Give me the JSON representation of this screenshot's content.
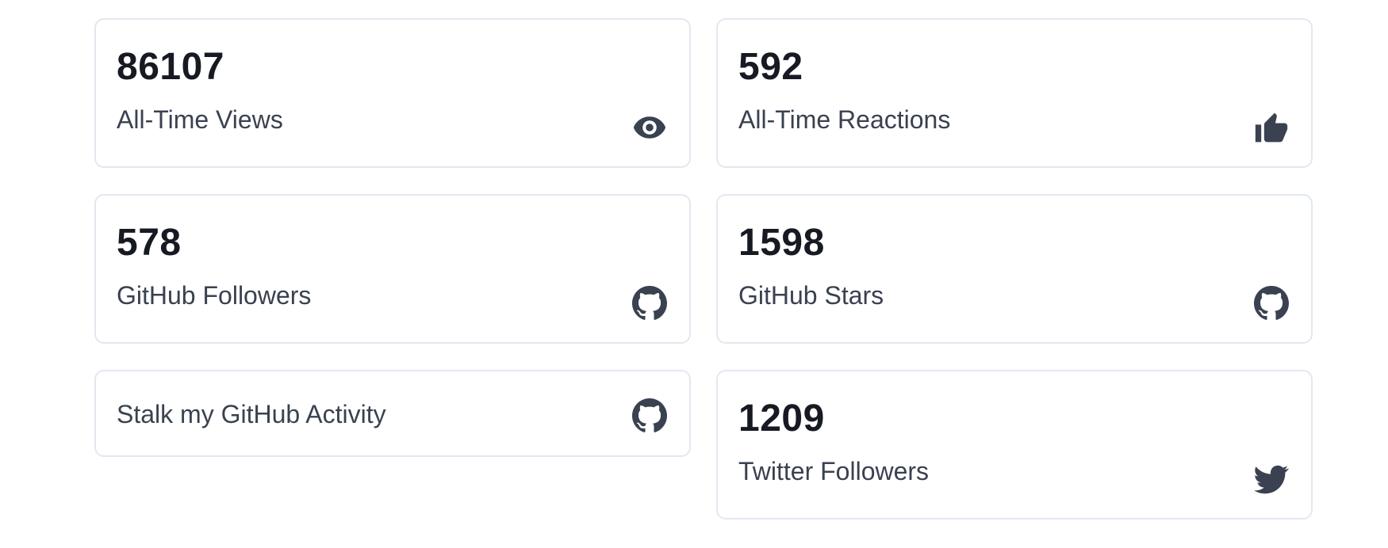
{
  "stats": {
    "views": {
      "value": "86107",
      "label": "All-Time Views",
      "icon": "eye-icon"
    },
    "reactions": {
      "value": "592",
      "label": "All-Time Reactions",
      "icon": "thumbs-up-icon"
    },
    "github_followers": {
      "value": "578",
      "label": "GitHub Followers",
      "icon": "github-icon"
    },
    "github_stars": {
      "value": "1598",
      "label": "GitHub Stars",
      "icon": "github-icon"
    },
    "github_activity": {
      "label": "Stalk my GitHub Activity",
      "icon": "github-icon"
    },
    "twitter_followers": {
      "value": "1209",
      "label": "Twitter Followers",
      "icon": "twitter-icon"
    }
  },
  "colors": {
    "value_text": "#171923",
    "label_text": "#3a4150",
    "card_border": "#e2e8f0",
    "background": "#ffffff"
  }
}
